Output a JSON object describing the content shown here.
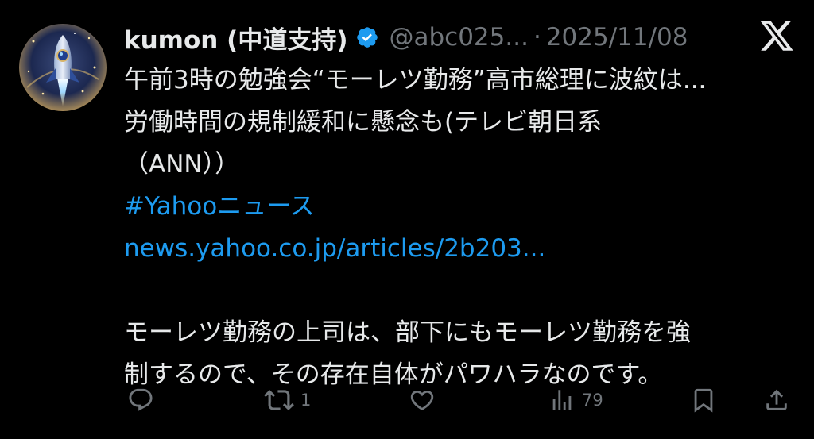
{
  "tweet": {
    "author": {
      "display_name": "kumon (中道支持)",
      "handle": "@abc025...",
      "verified": true,
      "verified_color": "#1d9bf0"
    },
    "separator": "·",
    "date": "2025/11/08",
    "lines": [
      "午前3時の勉強会“モーレツ勤務”高市総理に波紋は...",
      "労働時間の規制緩和に懸念も(テレビ朝日系",
      "（ANN））",
      "#Yahooニュース",
      "news.yahoo.co.jp/articles/2b203...",
      "",
      "モーレツ勤務の上司は、部下にもモーレツ勤務を強",
      "制するので、その存在自体がパワハラなのです。"
    ],
    "hashtag": "#Yahooニュース",
    "link_text": "news.yahoo.co.jp/articles/2b203...",
    "link_color": "#1d9bf0",
    "actions": {
      "reply_icon": "reply-icon",
      "retweet_icon": "retweet-icon",
      "retweet_count": "1",
      "like_icon": "like-icon",
      "views_icon": "views-icon",
      "views_count": "79",
      "bookmark_icon": "bookmark-icon",
      "share_icon": "share-icon"
    }
  },
  "brand": {
    "logo_icon": "x-logo-icon"
  },
  "colors": {
    "background": "#000000",
    "text": "#e7e9ea",
    "muted": "#71767b",
    "accent": "#1d9bf0"
  }
}
